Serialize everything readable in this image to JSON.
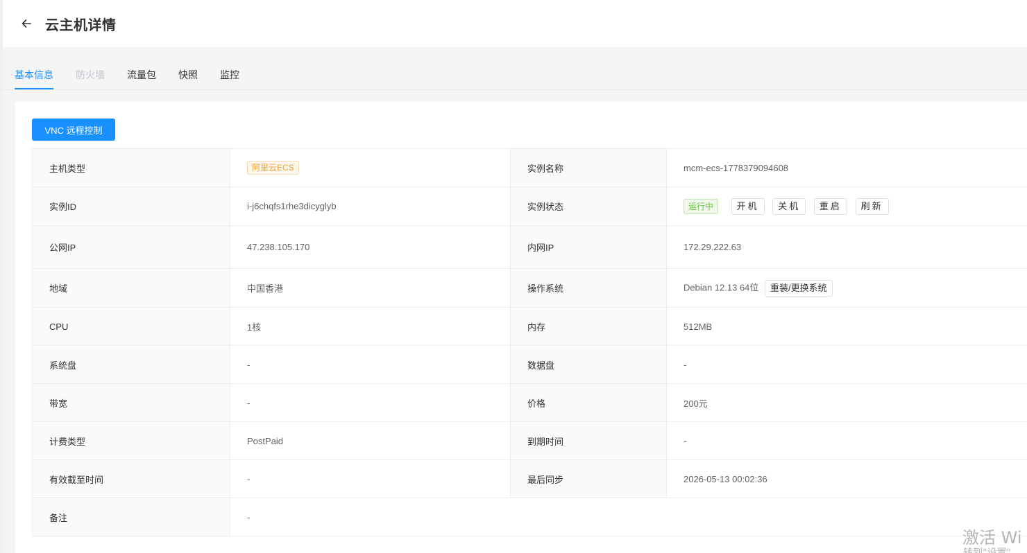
{
  "header": {
    "title": "云主机详情"
  },
  "tabs": [
    {
      "label": "基本信息"
    },
    {
      "label": "防火墙"
    },
    {
      "label": "流量包"
    },
    {
      "label": "快照"
    },
    {
      "label": "监控"
    }
  ],
  "actions": {
    "vnc_label": "VNC 远程控制"
  },
  "details": {
    "host_type": {
      "label": "主机类型",
      "value": "阿里云ECS"
    },
    "instance_name": {
      "label": "实例名称",
      "value": "mcm-ecs-1778379094608"
    },
    "instance_id": {
      "label": "实例ID",
      "value": "i-j6chqfs1rhe3dicyglyb"
    },
    "instance_status": {
      "label": "实例状态",
      "value": "运行中",
      "buttons": {
        "start": "开机",
        "stop": "关机",
        "reboot": "重启",
        "refresh": "刷新"
      }
    },
    "public_ip": {
      "label": "公网IP",
      "value": "47.238.105.170"
    },
    "private_ip": {
      "label": "内网IP",
      "value": "172.29.222.63"
    },
    "region": {
      "label": "地域",
      "value": "中国香港"
    },
    "os": {
      "label": "操作系统",
      "value": "Debian 12.13 64位",
      "button": "重装/更换系统"
    },
    "cpu": {
      "label": "CPU",
      "value": "1核"
    },
    "memory": {
      "label": "内存",
      "value": "512MB"
    },
    "system_disk": {
      "label": "系统盘",
      "value": "-"
    },
    "data_disk": {
      "label": "数据盘",
      "value": "-"
    },
    "bandwidth": {
      "label": "带宽",
      "value": "-"
    },
    "price": {
      "label": "价格",
      "value": "200元"
    },
    "billing_type": {
      "label": "计费类型",
      "value": "PostPaid"
    },
    "expire_time": {
      "label": "到期时间",
      "value": "-"
    },
    "valid_until": {
      "label": "有效截至时间",
      "value": "-"
    },
    "last_sync": {
      "label": "最后同步",
      "value": "2026-05-13 00:02:36"
    },
    "remark": {
      "label": "备注",
      "value": "-"
    }
  },
  "watermark": {
    "line1": "激活 Wi",
    "line2": "转到\"设置\""
  },
  "colors": {
    "primary": "#1890ff",
    "success": "#67c23a",
    "warning": "#e6a23c"
  }
}
